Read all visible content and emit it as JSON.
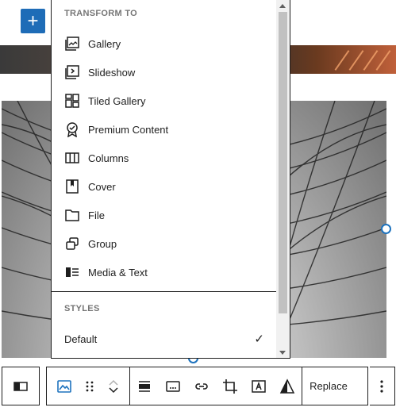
{
  "add_block": {
    "symbol": "+",
    "color": "#1e6cb7"
  },
  "transform": {
    "title": "TRANSFORM TO",
    "items": [
      {
        "label": "Gallery",
        "icon": "gallery-icon"
      },
      {
        "label": "Slideshow",
        "icon": "slideshow-icon"
      },
      {
        "label": "Tiled Gallery",
        "icon": "tiled-gallery-icon"
      },
      {
        "label": "Premium Content",
        "icon": "premium-content-icon"
      },
      {
        "label": "Columns",
        "icon": "columns-icon"
      },
      {
        "label": "Cover",
        "icon": "cover-icon"
      },
      {
        "label": "File",
        "icon": "file-icon"
      },
      {
        "label": "Group",
        "icon": "group-icon"
      },
      {
        "label": "Media & Text",
        "icon": "media-text-icon"
      }
    ]
  },
  "styles": {
    "title": "STYLES",
    "options": [
      {
        "label": "Default",
        "selected": true,
        "check": "✓"
      }
    ]
  },
  "toolbar": {
    "replace_label": "Replace",
    "link_fragment": "ct",
    "accent": "#1e73be"
  }
}
